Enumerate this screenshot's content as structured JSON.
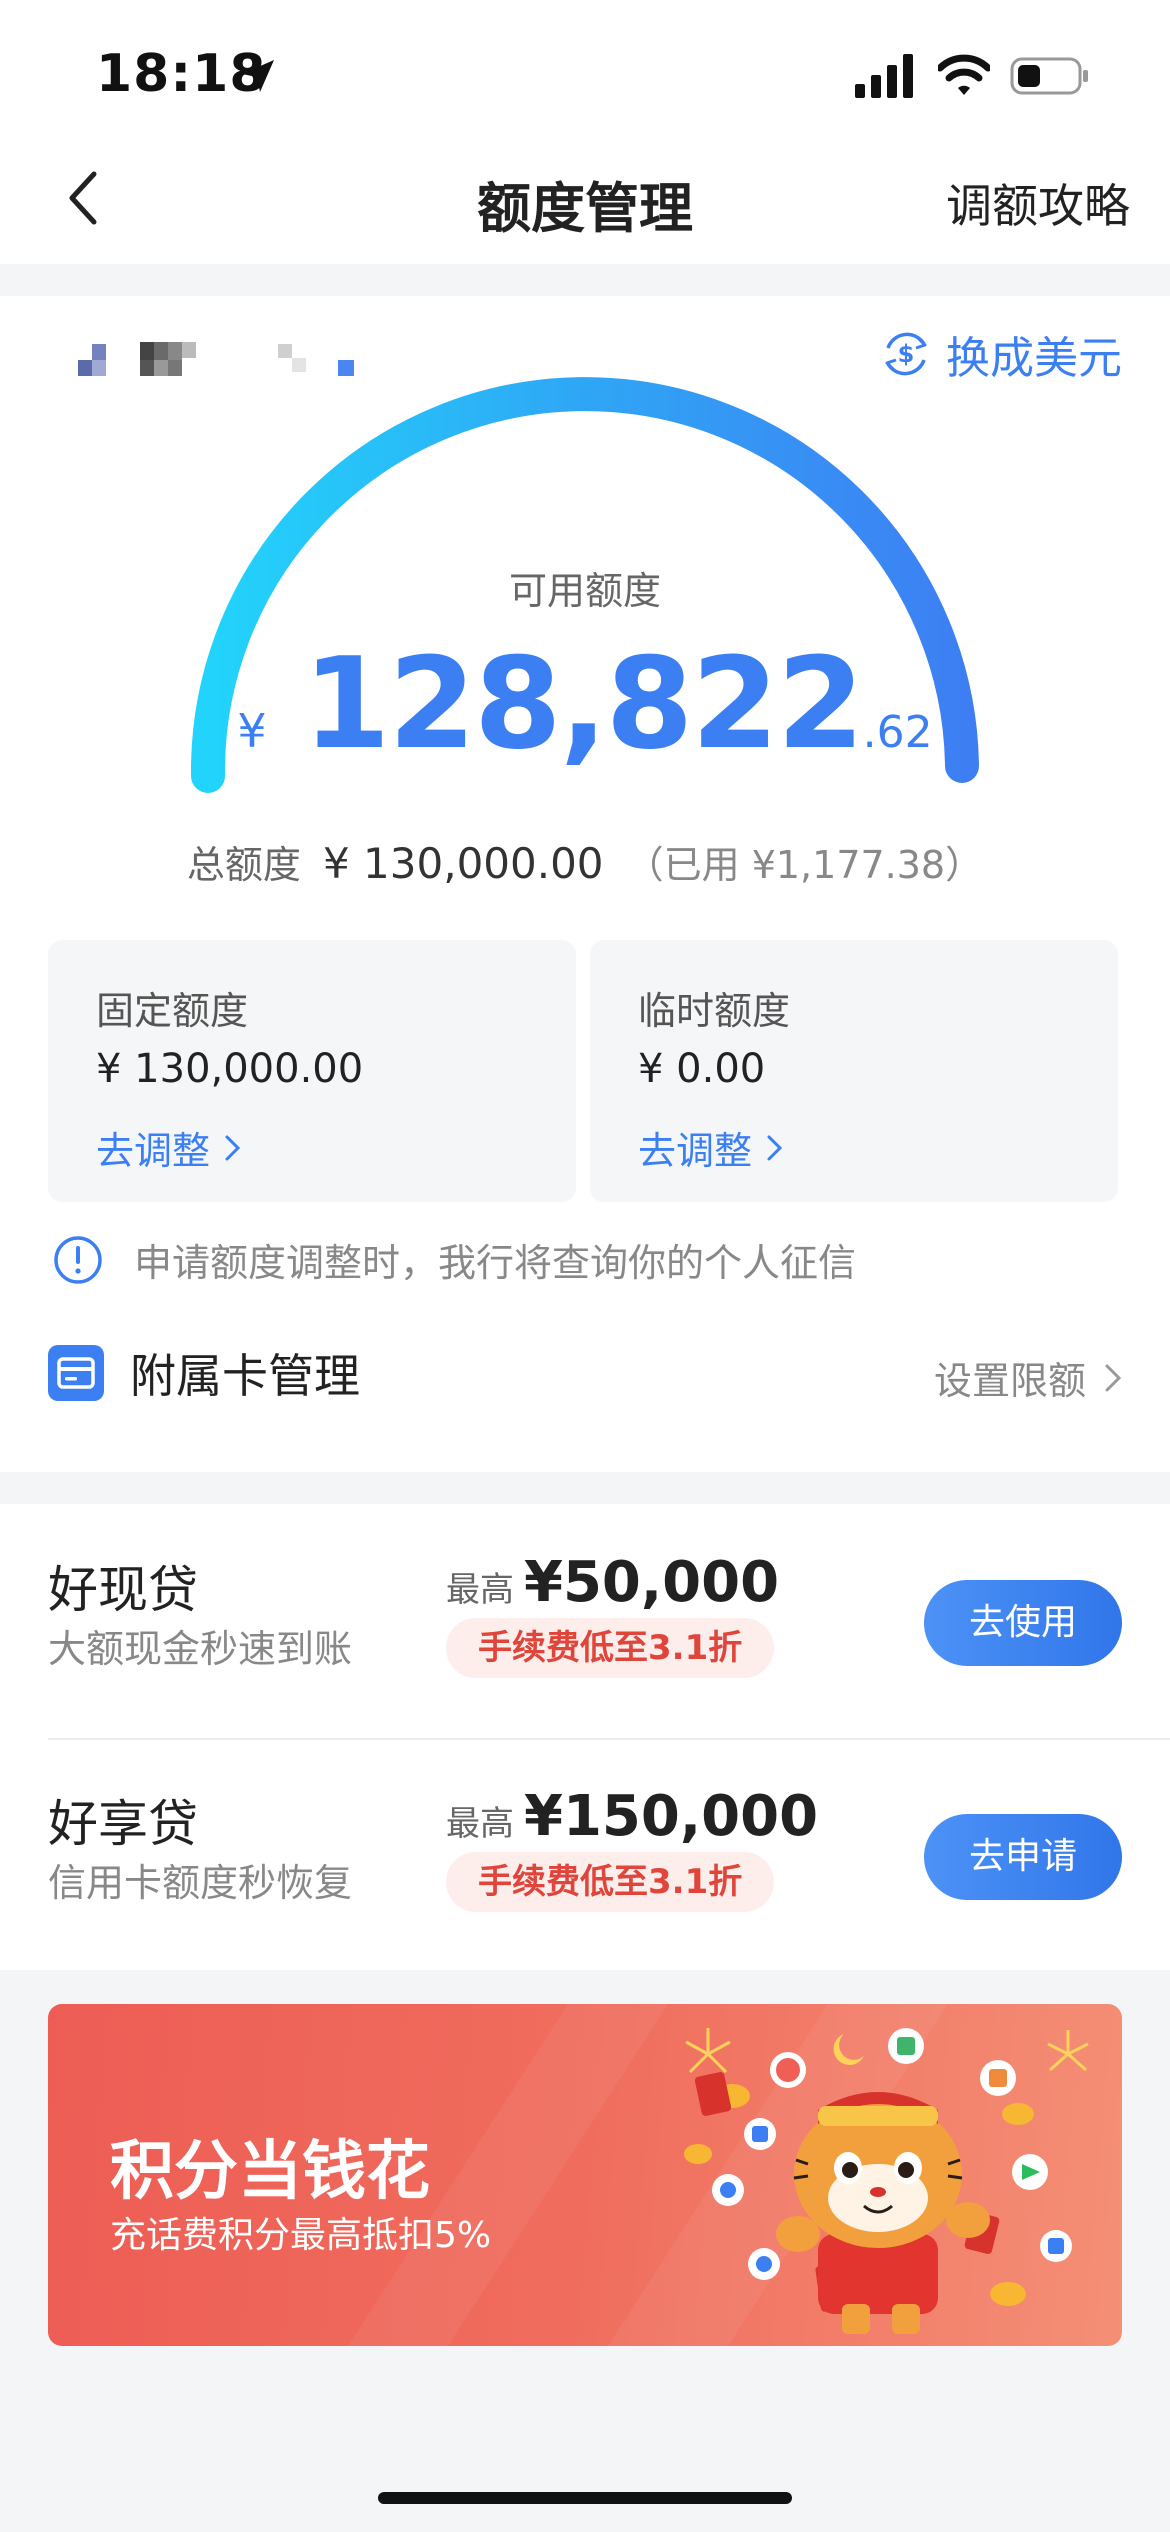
{
  "status_bar": {
    "time": "18:18"
  },
  "nav": {
    "title": "额度管理",
    "right_link": "调额攻略"
  },
  "currency_switch": {
    "label": "换成美元"
  },
  "credit": {
    "available_label": "可用额度",
    "currency_symbol": "¥",
    "available_integer": "128,822",
    "available_decimal": ".62",
    "total_label": "总额度",
    "total_value": "¥ 130,000.00",
    "used_text": "（已用 ¥1,177.38）",
    "gauge_colors": {
      "start": "#22d4fb",
      "end": "#3d7ff3"
    }
  },
  "limits": [
    {
      "title": "固定额度",
      "value": "¥ 130,000.00",
      "link": "去调整"
    },
    {
      "title": "临时额度",
      "value": "¥ 0.00",
      "link": "去调整"
    }
  ],
  "notice": {
    "text": "申请额度调整时，我行将查询你的个人征信"
  },
  "affiliate": {
    "title": "附属卡管理",
    "right_link": "设置限额"
  },
  "loans": [
    {
      "title": "好现贷",
      "subtitle": "大额现金秒速到账",
      "max_label": "最高",
      "max_amount": "¥50,000",
      "fee": "手续费低至3.1折",
      "button": "去使用"
    },
    {
      "title": "好享贷",
      "subtitle": "信用卡额度秒恢复",
      "max_label": "最高",
      "max_amount": "¥150,000",
      "fee": "手续费低至3.1折",
      "button": "去申请"
    }
  ],
  "banner": {
    "title": "积分当钱花",
    "subtitle": "充话费积分最高抵扣5%"
  },
  "colors": {
    "accent": "#3b7ff3",
    "fee_red": "#e0453b",
    "banner_red": "#ef5f56"
  }
}
